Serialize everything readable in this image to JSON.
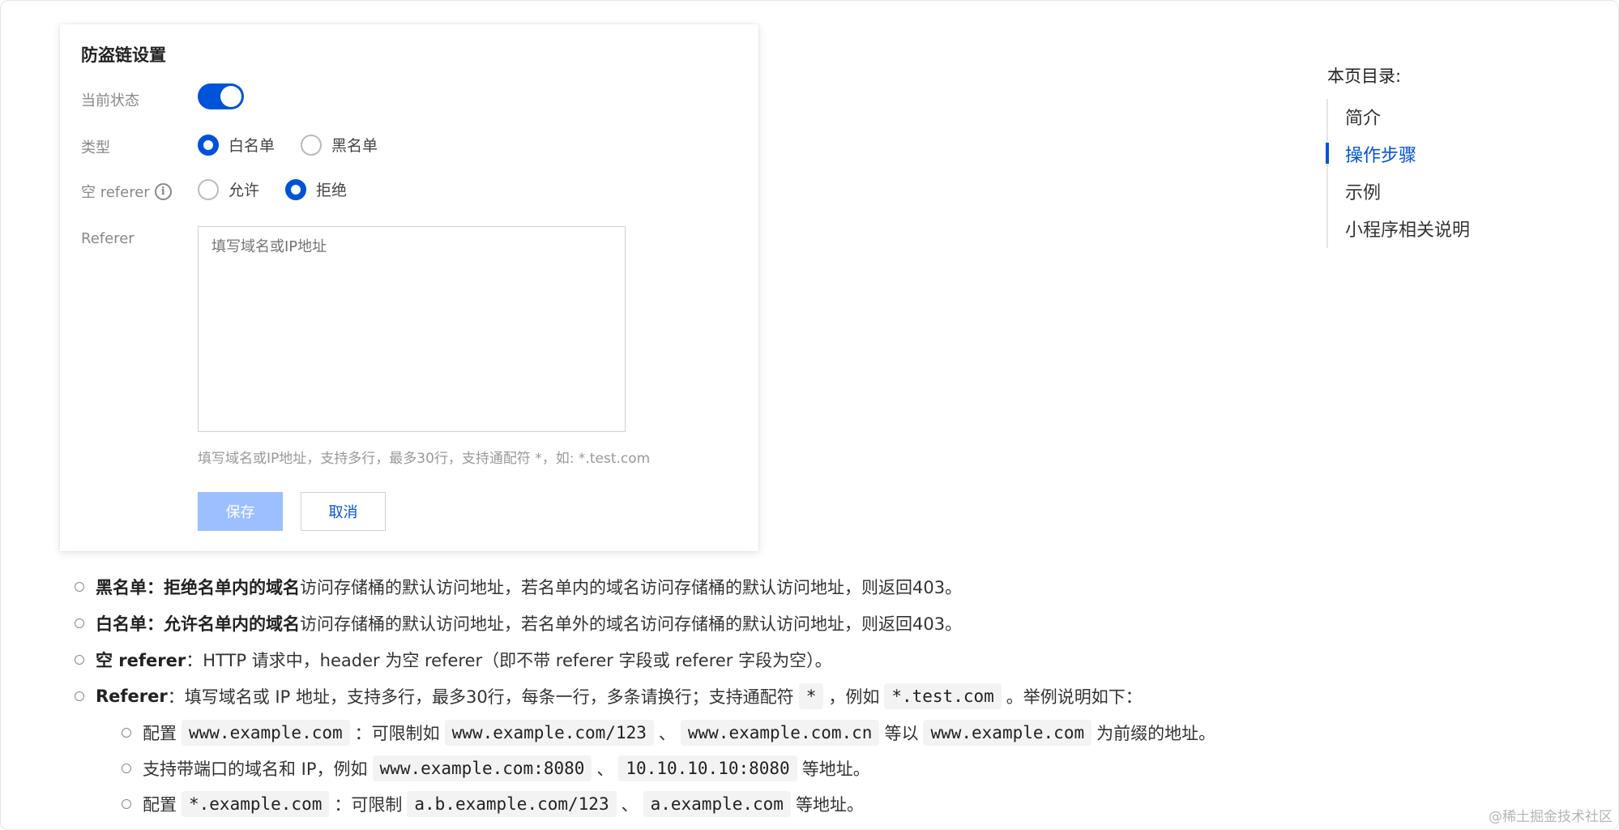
{
  "card": {
    "title": "防盗链设置",
    "status_label": "当前状态",
    "type_label": "类型",
    "type_options": [
      "白名单",
      "黑名单"
    ],
    "type_selected": "白名单",
    "empty_referer_label": "空 referer",
    "empty_referer_options": [
      "允许",
      "拒绝"
    ],
    "empty_referer_selected": "拒绝",
    "referer_label": "Referer",
    "referer_placeholder": "填写域名或IP地址",
    "referer_hint": "填写域名或IP地址，支持多行，最多30行，支持通配符 *，如: *.test.com",
    "save_label": "保存",
    "cancel_label": "取消"
  },
  "toc": {
    "title": "本页目录:",
    "items": [
      "简介",
      "操作步骤",
      "示例",
      "小程序相关说明"
    ],
    "active": "操作步骤"
  },
  "list": {
    "item1": {
      "term": "黑名单",
      "sep": "：",
      "bold": "拒绝名单内的域名",
      "rest": "访问存储桶的默认访问地址，若名单内的域名访问存储桶的默认访问地址，则返回403。"
    },
    "item2": {
      "term": "白名单",
      "sep": "：",
      "bold": "允许名单内的域名",
      "rest": "访问存储桶的默认访问地址，若名单外的域名访问存储桶的默认访问地址，则返回403。"
    },
    "item3": {
      "term": "空 referer",
      "rest": "：HTTP 请求中，header 为空 referer（即不带 referer 字段或 referer 字段为空）。"
    },
    "item4": {
      "term": "Referer",
      "rest": "：填写域名或 IP 地址，支持多行，最多30行，每条一行，多条请换行；支持通配符",
      "code1": "*",
      "mid": "，例如",
      "code2": "*.test.com",
      "end": "。举例说明如下："
    },
    "sub1": {
      "t1": "配置",
      "c1": "www.example.com",
      "t2": "：可限制如",
      "c2": "www.example.com/123",
      "t3": "、",
      "c3": "www.example.com.cn",
      "t4": "等以",
      "c4": "www.example.com",
      "t5": "为前缀的地址。"
    },
    "sub2": {
      "t1": "支持带端口的域名和 IP，例如",
      "c1": "www.example.com:8080",
      "t2": "、",
      "c2": "10.10.10.10:8080",
      "t3": "等地址。"
    },
    "sub3": {
      "t1": "配置",
      "c1": "*.example.com",
      "t2": "：可限制",
      "c2": "a.b.example.com/123",
      "t3": "、",
      "c3": "a.example.com",
      "t4": "等地址。"
    }
  },
  "watermark": "@稀土掘金技术社区",
  "colors": {
    "accent": "#0052d9",
    "save_disabled": "#9cc0ff"
  }
}
